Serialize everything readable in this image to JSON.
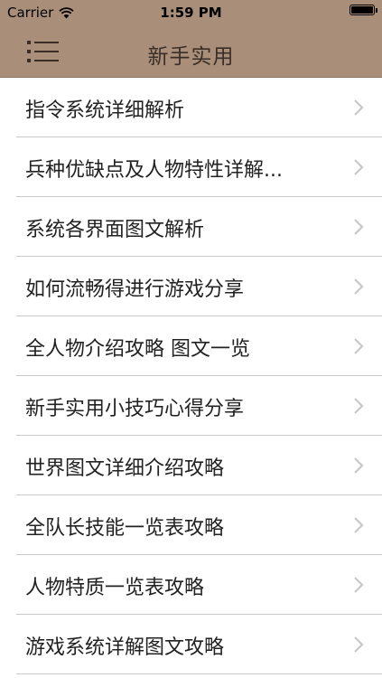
{
  "status_bar": {
    "carrier": "Carrier",
    "time": "1:59 PM",
    "battery_level": 1.0
  },
  "nav_bar": {
    "title": "新手实用",
    "menu_icon": "list-menu-icon"
  },
  "list": {
    "items": [
      {
        "label": "指令系统详细解析"
      },
      {
        "label": "兵种优缺点及人物特性详解..."
      },
      {
        "label": "系统各界面图文解析"
      },
      {
        "label": "如何流畅得进行游戏分享"
      },
      {
        "label": "全人物介绍攻略 图文一览"
      },
      {
        "label": "新手实用小技巧心得分享"
      },
      {
        "label": "世界图文详细介绍攻略"
      },
      {
        "label": "全队长技能一览表攻略"
      },
      {
        "label": "人物特质一览表攻略"
      },
      {
        "label": "游戏系统详解图文攻略"
      }
    ]
  },
  "colors": {
    "nav_background": "#a98f79",
    "title_text": "#3a2e26",
    "separator": "#c8c7cc",
    "chevron": "#c7c7cc"
  }
}
